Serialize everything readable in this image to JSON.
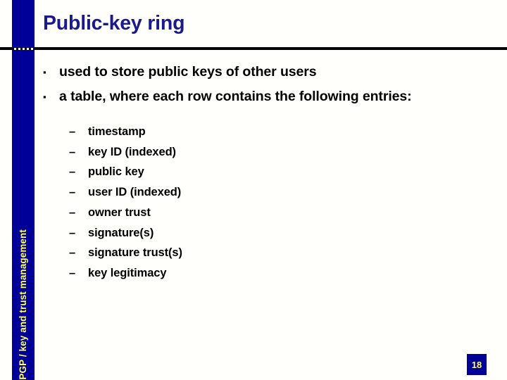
{
  "slide": {
    "title": "Public-key ring",
    "page_number": "18",
    "sidebar_label": "PGP / key and trust management",
    "colors": {
      "brand_blue": "#000099",
      "title_blue": "#1a1a8c",
      "accent_yellow": "#ffff66",
      "rule_black": "#000000",
      "background": "#fffffc"
    }
  },
  "bullets": {
    "level1_marker": "▪",
    "level2_marker": "–",
    "items": [
      {
        "text": "used to store public keys of other users"
      },
      {
        "text": "a table, where each row contains the following entries:"
      }
    ],
    "sub_items": [
      {
        "text": "timestamp"
      },
      {
        "text": "key ID (indexed)"
      },
      {
        "text": "public key"
      },
      {
        "text": "user ID (indexed)"
      },
      {
        "text": "owner trust"
      },
      {
        "text": "signature(s)"
      },
      {
        "text": "signature trust(s)"
      },
      {
        "text": "key legitimacy"
      }
    ]
  }
}
